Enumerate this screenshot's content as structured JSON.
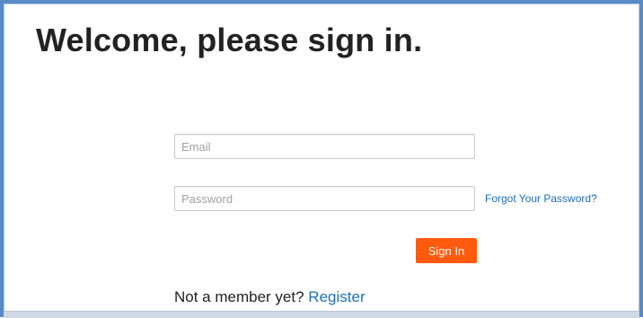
{
  "header": {
    "title": "Welcome, please sign in."
  },
  "form": {
    "email_placeholder": "Email",
    "email_value": "",
    "password_placeholder": "Password",
    "password_value": "",
    "forgot_label": "Forgot Your Password?",
    "signin_label": "Sign In"
  },
  "footer": {
    "prompt": "Not a member yet?",
    "register_label": "Register"
  },
  "colors": {
    "frame_border": "#5a8ac6",
    "button_bg": "#ff5a0d",
    "link": "#1f6fb5",
    "title_text": "#222222"
  }
}
